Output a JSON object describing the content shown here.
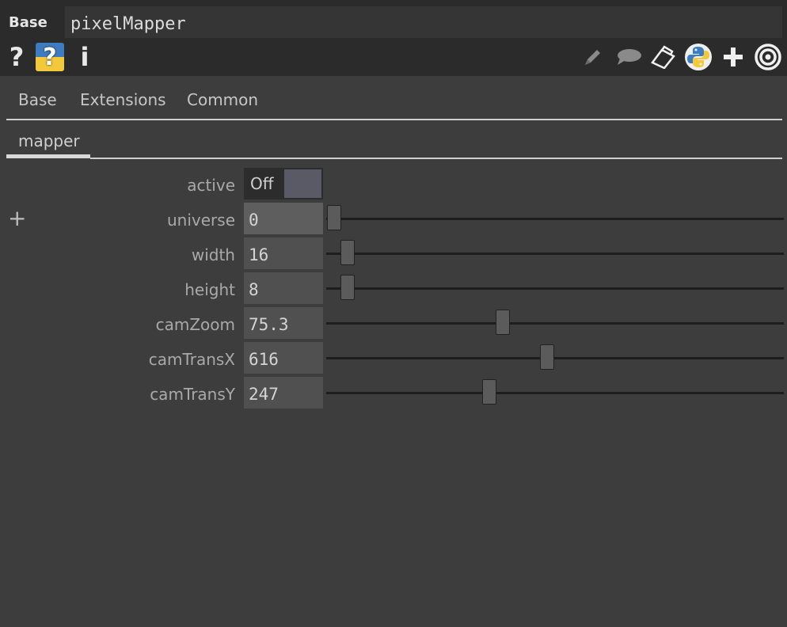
{
  "header": {
    "op_type": "Base",
    "op_name": "pixelMapper"
  },
  "toolbar": {
    "left_icons": [
      "help-icon",
      "python-help-icon",
      "info-icon"
    ],
    "help_glyph": "?",
    "python_help_glyph": "?",
    "info_glyph": "i",
    "right_icons": [
      "pencil-icon",
      "comment-icon",
      "clone-icon",
      "python-icon",
      "add-icon",
      "target-icon"
    ]
  },
  "tabs": {
    "top": [
      "Base",
      "Extensions",
      "Common"
    ],
    "page": "mapper"
  },
  "expand_glyph": "+",
  "params": {
    "active": {
      "label": "active",
      "value": "Off"
    },
    "universe": {
      "label": "universe",
      "value": "0",
      "slider_fraction": 0.0
    },
    "width": {
      "label": "width",
      "value": "16",
      "slider_fraction": 0.03
    },
    "height": {
      "label": "height",
      "value": "8",
      "slider_fraction": 0.03
    },
    "camZoom": {
      "label": "camZoom",
      "value": "75.3",
      "slider_fraction": 0.38
    },
    "camTransX": {
      "label": "camTransX",
      "value": "616",
      "slider_fraction": 0.48
    },
    "camTransY": {
      "label": "camTransY",
      "value": "247",
      "slider_fraction": 0.35
    }
  },
  "colors": {
    "background": "#3d3d3d",
    "toggle_knob": "#5a5a66",
    "python_blue": "#3e7bbf",
    "python_yellow": "#f2c93b"
  }
}
